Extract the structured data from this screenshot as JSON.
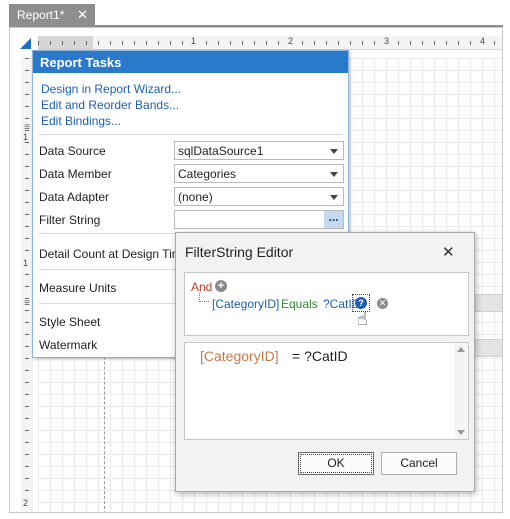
{
  "tab": {
    "title": "Report1*",
    "close_glyph": "✕"
  },
  "rulers": {
    "horizontal_numbers": [
      "1",
      "2",
      "3",
      "4"
    ],
    "vertical_numbers": [
      "1",
      "1",
      "2"
    ]
  },
  "report_tasks": {
    "title": "Report Tasks",
    "links": [
      "Design in Report Wizard...",
      "Edit and Reorder Bands...",
      "Edit Bindings..."
    ],
    "data_source": {
      "label": "Data Source",
      "value": "sqlDataSource1"
    },
    "data_member": {
      "label": "Data Member",
      "value": "Categories"
    },
    "data_adapter": {
      "label": "Data Adapter",
      "value": "(none)"
    },
    "filter_string": {
      "label": "Filter String",
      "value": "",
      "button": "..."
    },
    "detail_count": {
      "label": "Detail Count at Design Time"
    },
    "measure_units": {
      "label": "Measure Units"
    },
    "style_sheet": {
      "label": "Style Sheet"
    },
    "watermark": {
      "label": "Watermark"
    }
  },
  "filter_editor": {
    "title": "FilterString Editor",
    "close_glyph": "✕",
    "group_operator": "And",
    "condition": {
      "field": "[CategoryID]",
      "operator": "Equals",
      "parameter": "?CatID"
    },
    "expression": {
      "field": "[CategoryID]",
      "rest": "= ?CatID"
    },
    "ok_label": "OK",
    "cancel_label": "Cancel"
  },
  "colors": {
    "header_blue": "#2a7acc",
    "link_blue": "#1d5fb0",
    "operator_green": "#2e8b2e",
    "and_red": "#c0392b",
    "expression_field_orange": "#c77a4a"
  }
}
